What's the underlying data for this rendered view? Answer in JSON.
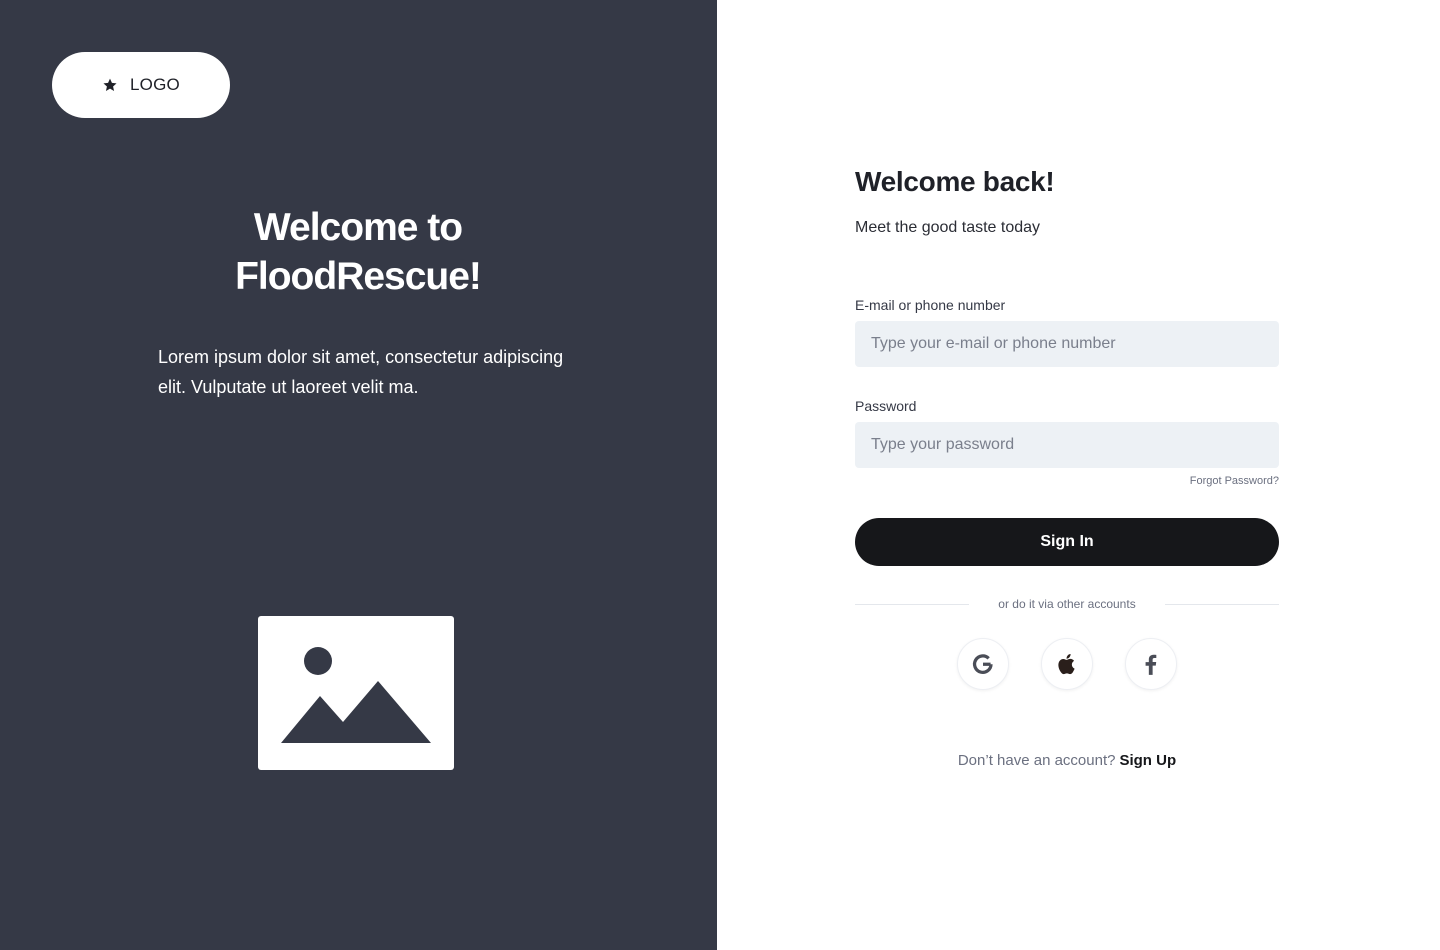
{
  "brand": {
    "logo_label": "LOGO",
    "logo_icon": "star-icon"
  },
  "hero": {
    "title": "Welcome to FloodRescue!",
    "description": "Lorem ipsum dolor sit amet, consectetur adipiscing elit. Vulputate ut laoreet velit ma.",
    "image_icon": "image-placeholder-icon"
  },
  "form": {
    "title": "Welcome back!",
    "subtitle": "Meet the good taste today",
    "email_label": "E-mail or phone number",
    "email_placeholder": "Type your e-mail or phone number",
    "email_value": "",
    "password_label": "Password",
    "password_placeholder": "Type your password",
    "password_value": "",
    "forgot_label": "Forgot Password?",
    "signin_label": "Sign In",
    "divider_text": "or do it via other accounts",
    "social": [
      {
        "name": "google",
        "icon": "google-icon"
      },
      {
        "name": "apple",
        "icon": "apple-icon"
      },
      {
        "name": "facebook",
        "icon": "facebook-icon"
      }
    ],
    "signup_question": "Don’t have an account?",
    "signup_link": "Sign Up"
  },
  "colors": {
    "left_panel": "#353946",
    "button": "#16171a",
    "input_bg": "#edf1f5",
    "muted_text": "#6b7080"
  }
}
